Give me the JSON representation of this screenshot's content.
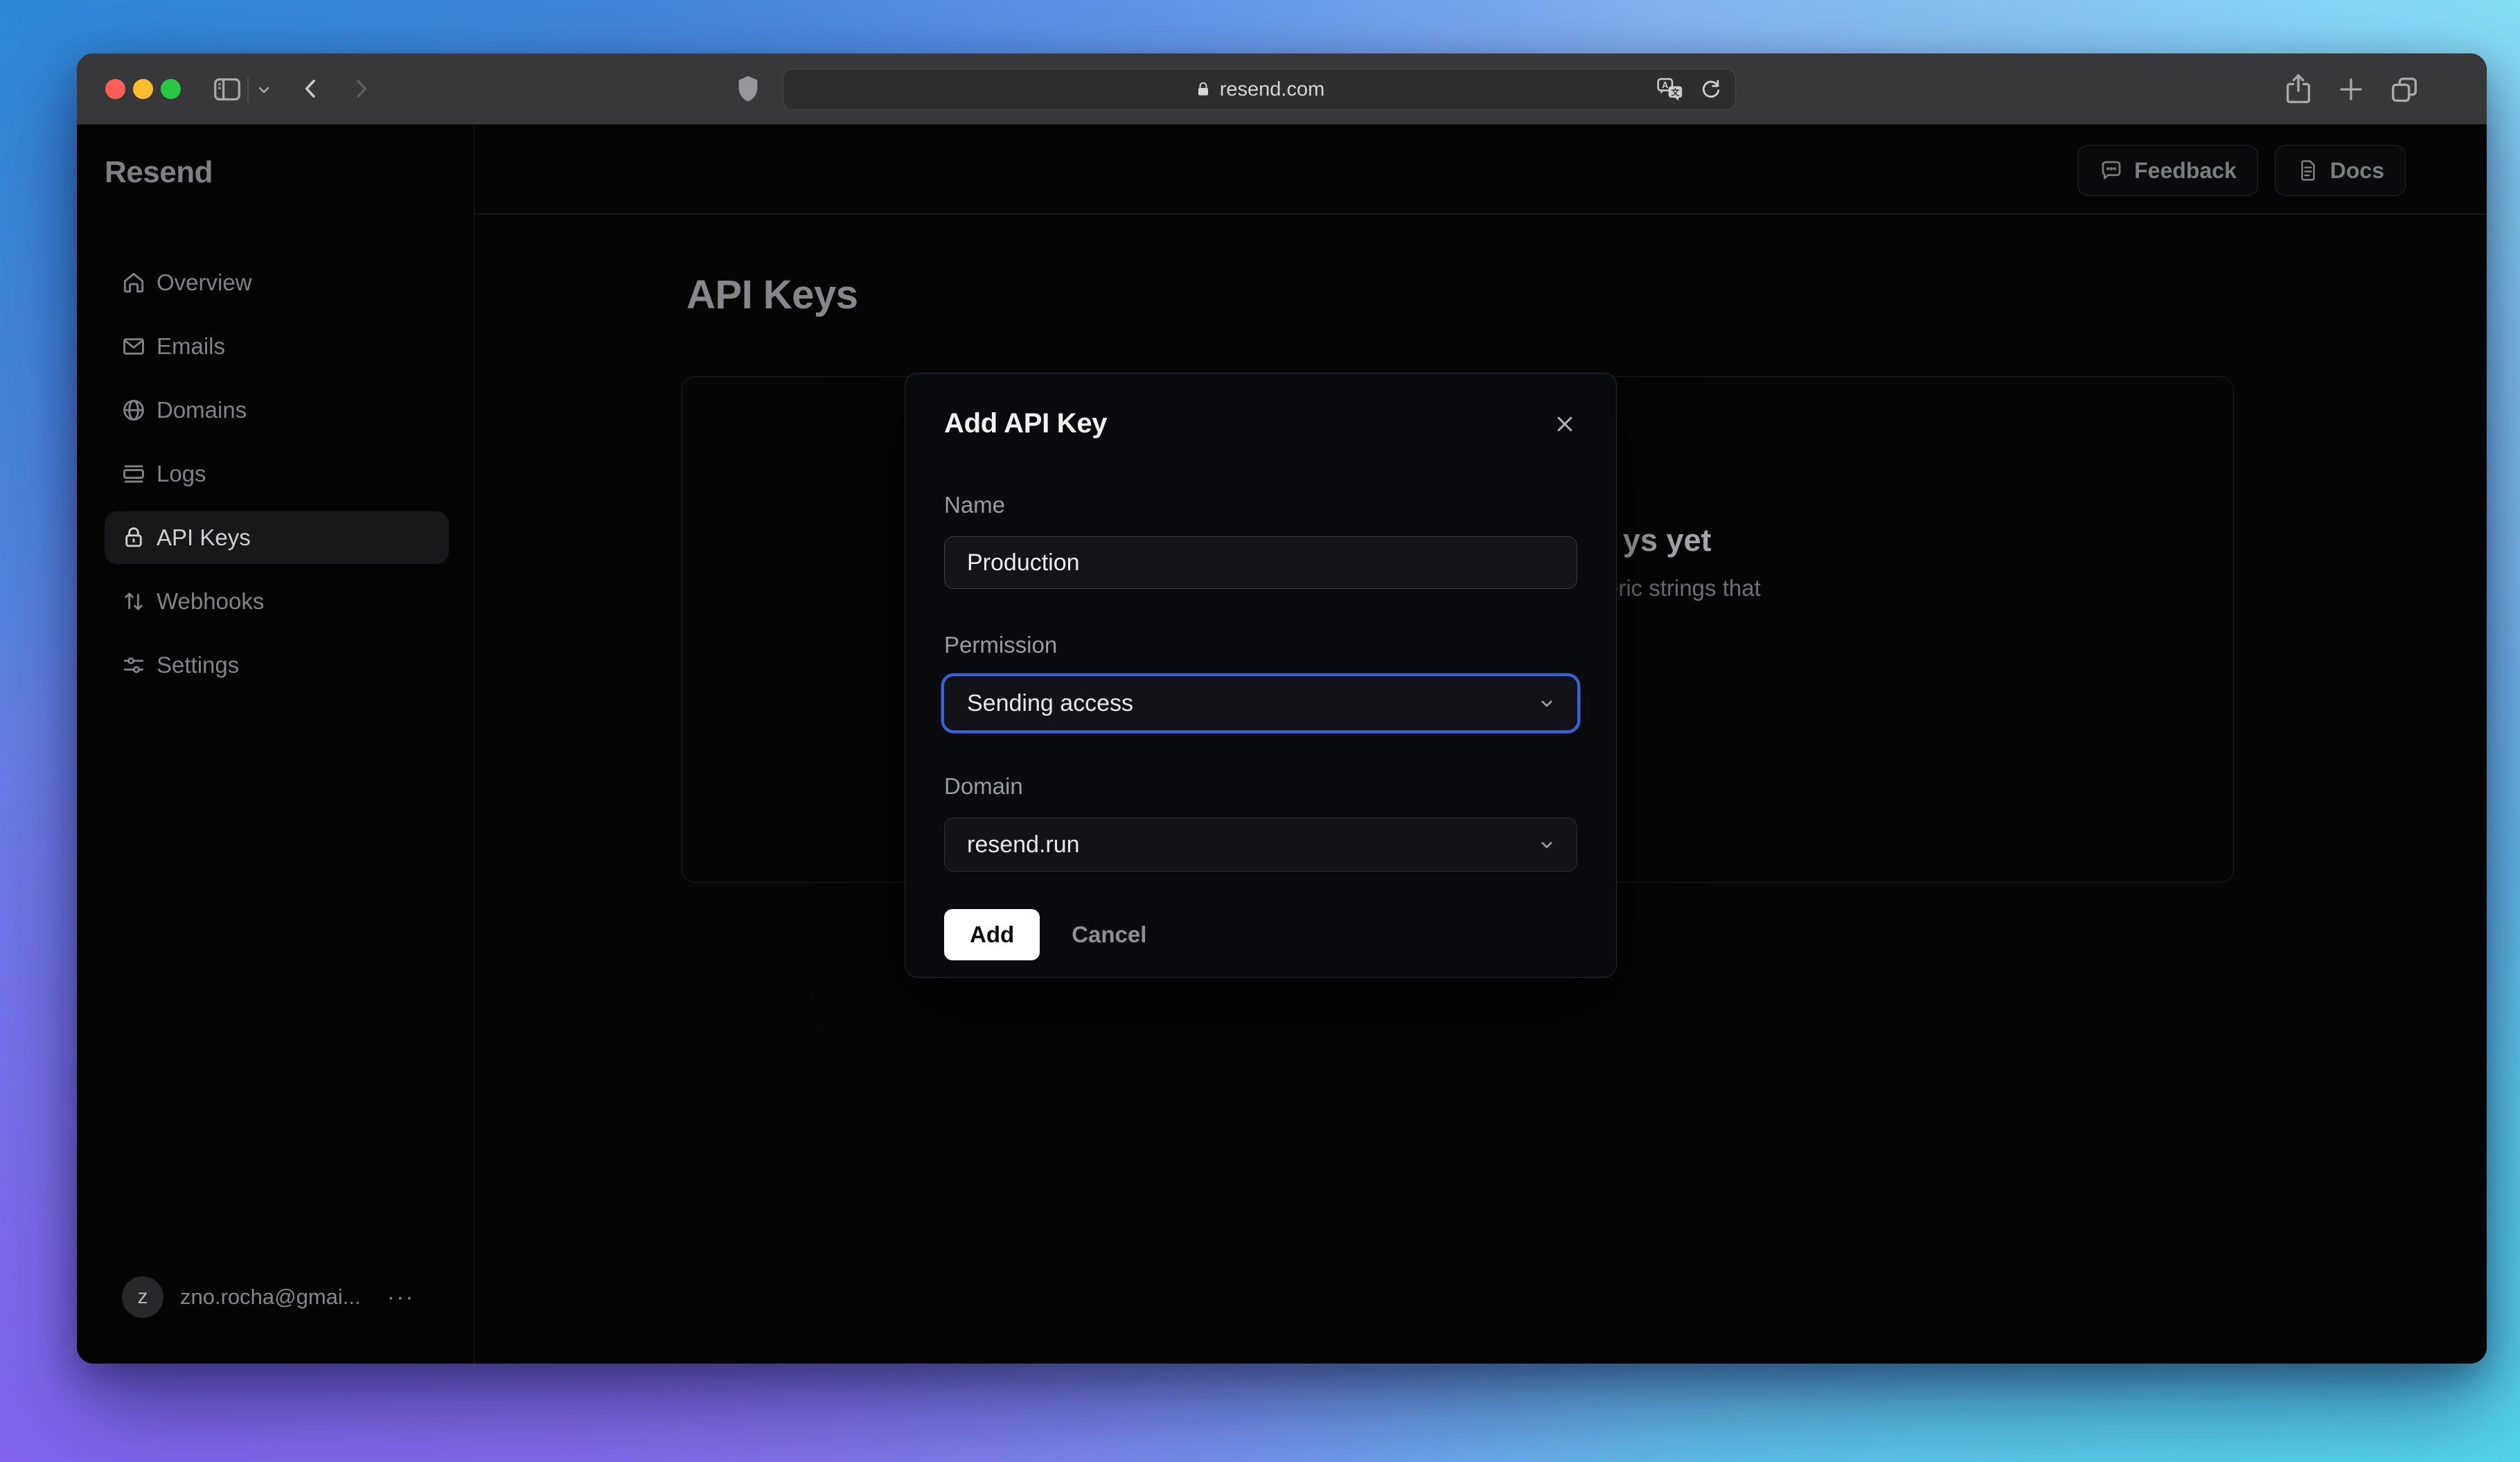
{
  "browser": {
    "url": "resend.com"
  },
  "sidebar": {
    "logo": "Resend",
    "items": [
      {
        "label": "Overview",
        "icon": "home-icon",
        "active": false
      },
      {
        "label": "Emails",
        "icon": "mail-icon",
        "active": false
      },
      {
        "label": "Domains",
        "icon": "globe-icon",
        "active": false
      },
      {
        "label": "Logs",
        "icon": "logs-icon",
        "active": false
      },
      {
        "label": "API Keys",
        "icon": "lock-icon",
        "active": true
      },
      {
        "label": "Webhooks",
        "icon": "arrows-icon",
        "active": false
      },
      {
        "label": "Settings",
        "icon": "sliders-icon",
        "active": false
      }
    ],
    "account": {
      "avatar_letter": "z",
      "email": "zno.rocha@gmai...",
      "menu_label": "···"
    }
  },
  "topbar": {
    "feedback_label": "Feedback",
    "docs_label": "Docs"
  },
  "main": {
    "title": "API Keys",
    "empty_state": {
      "heading_fragment": "ys yet",
      "body_fragment": "eric strings that"
    }
  },
  "modal": {
    "title": "Add API Key",
    "name_label": "Name",
    "name_value": "Production",
    "permission_label": "Permission",
    "permission_value": "Sending access",
    "domain_label": "Domain",
    "domain_value": "resend.run",
    "add_label": "Add",
    "cancel_label": "Cancel"
  },
  "colors": {
    "focus_ring": "#3a62d4",
    "traffic_red": "#ff5f57",
    "traffic_yellow": "#febc2e",
    "traffic_green": "#28c840"
  }
}
